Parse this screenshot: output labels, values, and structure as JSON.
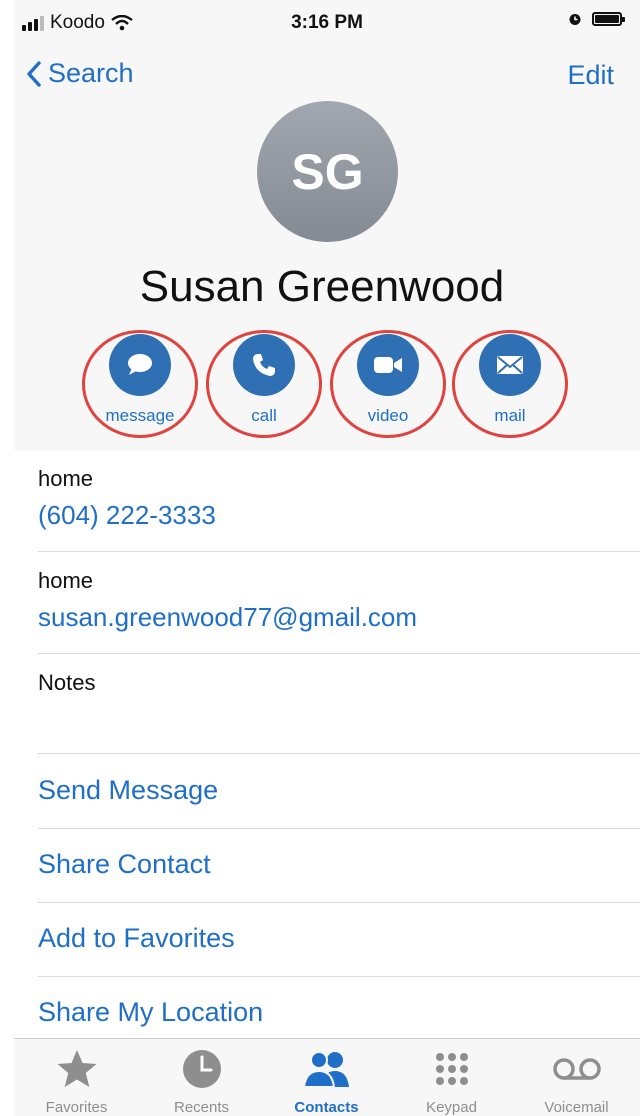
{
  "status_bar": {
    "carrier": "Koodo",
    "time": "3:16 PM",
    "icons": [
      "signal-icon",
      "wifi-icon",
      "alarm-icon",
      "battery-icon"
    ]
  },
  "nav": {
    "back_label": "Search",
    "edit_label": "Edit"
  },
  "contact": {
    "initials": "SG",
    "name": "Susan Greenwood"
  },
  "actions": [
    {
      "label": "message",
      "icon": "message-icon"
    },
    {
      "label": "call",
      "icon": "phone-icon"
    },
    {
      "label": "video",
      "icon": "video-icon"
    },
    {
      "label": "mail",
      "icon": "mail-icon"
    }
  ],
  "details": {
    "phone": {
      "label": "home",
      "value": "(604) 222-3333"
    },
    "email": {
      "label": "home",
      "value": "susan.greenwood77@gmail.com"
    },
    "notes": {
      "label": "Notes"
    }
  },
  "links": [
    "Send Message",
    "Share Contact",
    "Add to Favorites",
    "Share My Location"
  ],
  "tabs": [
    {
      "label": "Favorites",
      "icon": "star-icon"
    },
    {
      "label": "Recents",
      "icon": "clock-icon"
    },
    {
      "label": "Contacts",
      "icon": "contacts-icon",
      "active": true
    },
    {
      "label": "Keypad",
      "icon": "keypad-icon"
    },
    {
      "label": "Voicemail",
      "icon": "voicemail-icon"
    }
  ],
  "colors": {
    "accent": "#1f6fc9",
    "action_fill": "#2f6fb4",
    "annotation_ring": "#e0423d",
    "avatar": "#9096a0"
  }
}
